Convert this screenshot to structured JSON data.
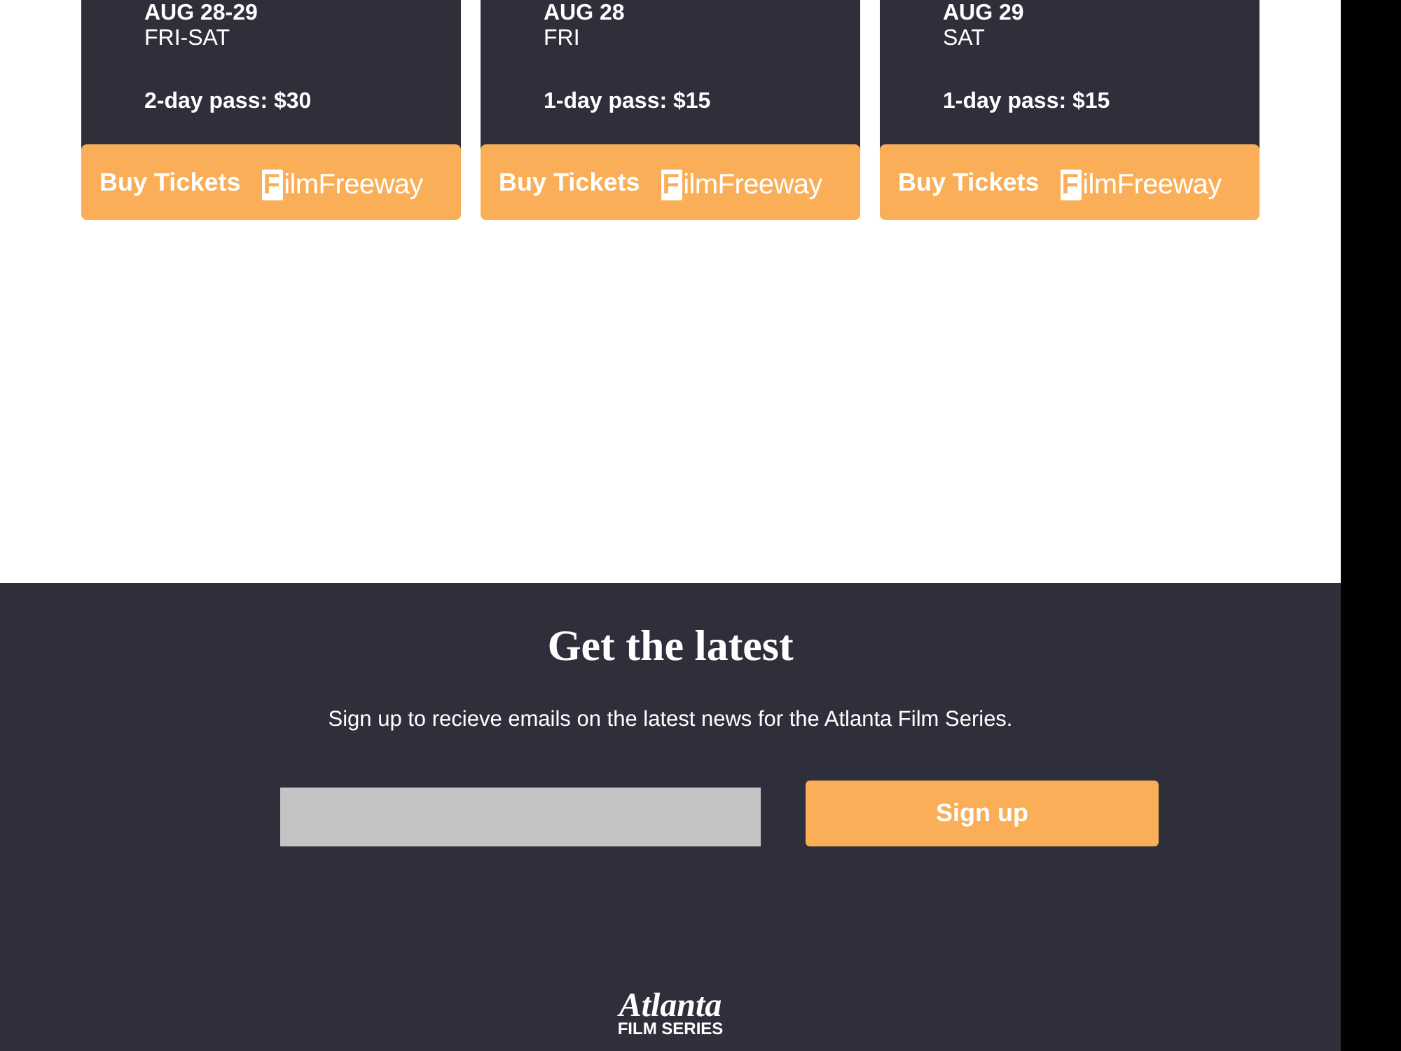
{
  "passes": [
    {
      "date": "AUG 28-29",
      "days": "FRI-SAT",
      "price": "2-day pass: $30",
      "button": "Buy Tickets",
      "logo": "FilmFreeway"
    },
    {
      "date": "AUG 28",
      "days": "FRI",
      "price": "1-day pass: $15",
      "button": "Buy Tickets",
      "logo": "FilmFreeway"
    },
    {
      "date": "AUG 29",
      "days": "SAT",
      "price": "1-day pass: $15",
      "button": "Buy Tickets",
      "logo": "FilmFreeway"
    }
  ],
  "newsletter": {
    "title": "Get the latest",
    "text": "Sign up to recieve emails on the latest news for the Atlanta Film Series.",
    "button": "Sign up"
  },
  "footer_logo": {
    "name": "Atlanta",
    "tagline": "FILM SERIES"
  }
}
